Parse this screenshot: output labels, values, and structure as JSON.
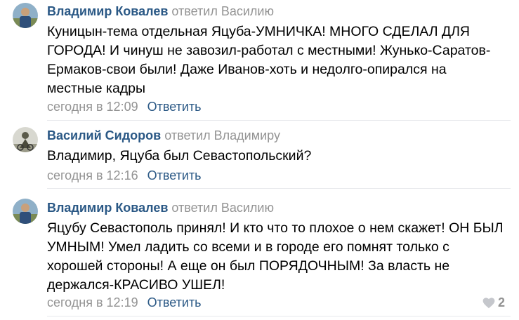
{
  "comments": [
    {
      "author": "Владимир Ковалев",
      "replied_to": "ответил Василию",
      "text_lines": [
        "Куницын-тема отдельная Яцуба-УМНИЧКА! МНОГО СДЕЛАЛ ДЛЯ",
        "ГОРОДА! И чинуш не завозил-работал с местными! Жунько-Саратов-",
        "Ермаков-свои были! Даже Иванов-хоть и недолго-опирался на",
        "местные кадры"
      ],
      "time": "сегодня в 12:09",
      "reply_label": "Ответить"
    },
    {
      "author": "Василий Сидоров",
      "replied_to": "ответил Владимиру",
      "text_lines": [
        "Владимир, Яцуба был Севастопольский?"
      ],
      "time": "сегодня в 12:16",
      "reply_label": "Ответить"
    },
    {
      "author": "Владимир Ковалев",
      "replied_to": "ответил Василию",
      "text_lines": [
        "Яцубу Севастополь принял! И кто что то плохое о нем скажет! ОН БЫЛ",
        "УМНЫМ! Умел ладить со всеми и в городе его помнят только с",
        "хорошей стороны! А еще он был ПОРЯДОЧНЫМ! За власть не",
        "держался-КРАСИВО УШЕЛ!"
      ],
      "time": "сегодня в 12:19",
      "reply_label": "Ответить",
      "likes": "2"
    }
  ],
  "icons": {
    "like": "heart-icon",
    "avatar": "user-avatar"
  },
  "colors": {
    "author": "#2a5885",
    "muted": "#939393",
    "divider": "#e7e8ec"
  }
}
